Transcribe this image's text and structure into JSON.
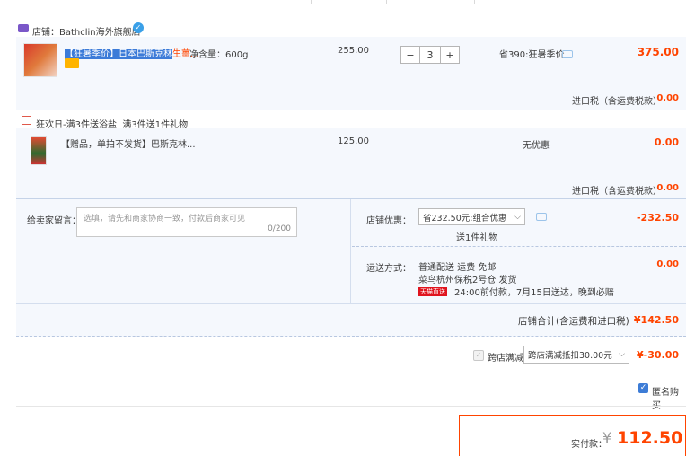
{
  "shop": {
    "label": "店铺：",
    "name": "Bathclin海外旗舰店"
  },
  "item1": {
    "title_highlight": "【狂暑季价】日本巴斯克林",
    "title_rest": "生薑...",
    "spec": "净含量：600g",
    "unit_price": "255.00",
    "quantity": "3",
    "discount": "省390:狂暑季价",
    "subtotal": "375.00",
    "tax_label": "进口税（含运费税款）",
    "tax_value": "0.00"
  },
  "promo": {
    "text": "狂欢日-满3件送浴盐",
    "sub": "满3件送1件礼物"
  },
  "item2": {
    "title": "【赠品，单拍不发货】巴斯克林...",
    "unit_price": "125.00",
    "discount": "无优惠",
    "subtotal": "0.00",
    "tax_label": "进口税（含运费税款）",
    "tax_value": "0.00"
  },
  "message": {
    "label": "给卖家留言：",
    "placeholder": "选填，请先和商家协商一致，付款后商家可见",
    "counter": "0/200"
  },
  "shop_discount": {
    "label": "店铺优惠：",
    "selected": "省232.50元:组合优惠",
    "gift": "送1件礼物",
    "value": "-232.50"
  },
  "shipping": {
    "label": "运送方式：",
    "line1": "普通配送 运费 免邮",
    "line2": "菜鸟杭州保税2号仓   发货",
    "badge": "天猫直送",
    "line3": "24:00前付款，7月15日送达，晚到必赔",
    "value": "0.00"
  },
  "shop_total": {
    "label": "店铺合计(含运费和进口税)",
    "value": "¥142.50"
  },
  "cross_store": {
    "label": "跨店满减",
    "selected": "跨店满减抵扣30.00元",
    "value": "¥-30.00"
  },
  "anonymous": {
    "label": "匿名购买"
  },
  "payment": {
    "label": "实付款：",
    "currency": "¥",
    "amount": "112.50"
  }
}
